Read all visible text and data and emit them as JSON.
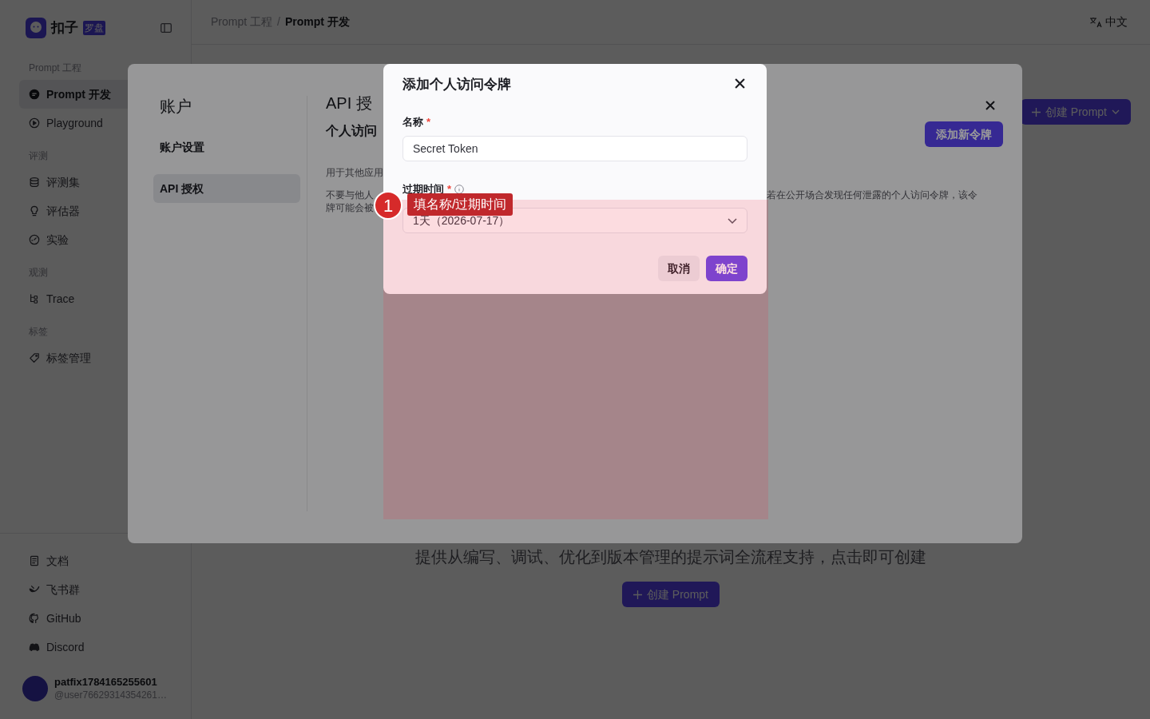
{
  "sidebar": {
    "logo": {
      "name": "扣子",
      "badge": "罗盘"
    },
    "sections": [
      {
        "title": "Prompt 工程",
        "items": [
          {
            "label": "Prompt 开发",
            "selected": true
          },
          {
            "label": "Playground",
            "selected": false
          }
        ]
      },
      {
        "title": "评测",
        "items": [
          {
            "label": "评测集",
            "selected": false
          },
          {
            "label": "评估器",
            "selected": false
          },
          {
            "label": "实验",
            "selected": false
          }
        ]
      },
      {
        "title": "观测",
        "items": [
          {
            "label": "Trace",
            "selected": false
          }
        ]
      },
      {
        "title": "标签",
        "items": [
          {
            "label": "标签管理",
            "selected": false
          }
        ]
      }
    ],
    "links": [
      "文档",
      "飞书群",
      "GitHub",
      "Discord"
    ],
    "user": {
      "name": "patfix1784165255601",
      "handle": "@user76629314354261…"
    }
  },
  "header": {
    "breadcrumb": [
      "Prompt 工程",
      "Prompt 开发"
    ],
    "breadcrumb_separator": "/",
    "language": "中文"
  },
  "main": {
    "create_button": "创建 Prompt",
    "empty_text": "提供从编写、调试、优化到版本管理的提示词全流程支持，点击即可创建",
    "empty_button": "创建 Prompt"
  },
  "settings": {
    "title": "账户",
    "menu": [
      {
        "label": "账户设置",
        "selected": false
      },
      {
        "label": "API 授权",
        "selected": true
      }
    ],
    "content_title": "API 授",
    "content_subtitle": "个人访问",
    "add_button": "添加新令牌",
    "notes_left": [
      "用于其他应用",
      "不要与他人",
      "牌可能会被"
    ],
    "notes_right": "若在公开场合发现任何泄露的个人访问令牌，该令"
  },
  "dialog": {
    "title": "添加个人访问令牌",
    "fields": [
      {
        "kind": "input",
        "label": "名称",
        "required_mark": "*",
        "value": "Secret Token"
      },
      {
        "kind": "select",
        "label": "过期时间",
        "required_mark": "*",
        "value": "1天（2026-07-17）"
      }
    ],
    "cancel": "取消",
    "confirm": "确定"
  },
  "annotation": {
    "number": "1",
    "text": "填名称/过期时间"
  }
}
